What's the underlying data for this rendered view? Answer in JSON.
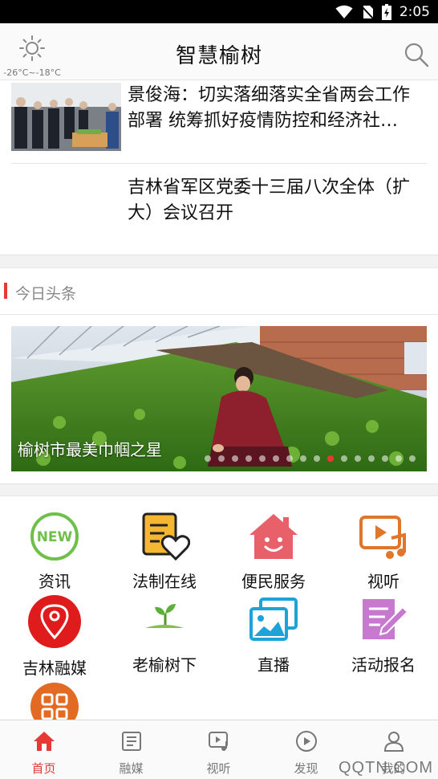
{
  "status_bar": {
    "time": "2:05"
  },
  "header": {
    "title": "智慧榆树",
    "weather_temp": "-26°C~-18°C"
  },
  "news": [
    {
      "headline": "景俊海：切实落细落实全省两会工作部署 统筹抓好疫情防控和经济社…"
    },
    {
      "headline": "吉林省军区党委十三届八次全体（扩大）会议召开"
    }
  ],
  "section": {
    "title": "今日头条"
  },
  "banner": {
    "caption": "榆树市最美巾帼之星",
    "slide_count": 16,
    "active_slide": 9
  },
  "grid": [
    {
      "label": "资讯",
      "icon": "new-icon"
    },
    {
      "label": "法制在线",
      "icon": "document-heart-icon"
    },
    {
      "label": "便民服务",
      "icon": "house-smile-icon"
    },
    {
      "label": "视听",
      "icon": "video-music-icon"
    },
    {
      "label": "吉林融媒",
      "icon": "location-pin-icon"
    },
    {
      "label": "老榆树下",
      "icon": "sprout-icon"
    },
    {
      "label": "直播",
      "icon": "image-gallery-icon"
    },
    {
      "label": "活动报名",
      "icon": "edit-note-icon"
    },
    {
      "label": "",
      "icon": "grid-apps-icon"
    }
  ],
  "bottom_nav": [
    {
      "label": "首页",
      "icon": "home-icon",
      "active": true
    },
    {
      "label": "融媒",
      "icon": "news-icon",
      "active": false
    },
    {
      "label": "视听",
      "icon": "video-icon",
      "active": false
    },
    {
      "label": "发现",
      "icon": "discover-icon",
      "active": false
    },
    {
      "label": "我的",
      "icon": "user-icon",
      "active": false
    }
  ],
  "watermark": "QQTN.COM",
  "colors": {
    "accent": "#e53935",
    "header_bg": "#fafafa",
    "gap_bg": "#f2f2f2"
  }
}
